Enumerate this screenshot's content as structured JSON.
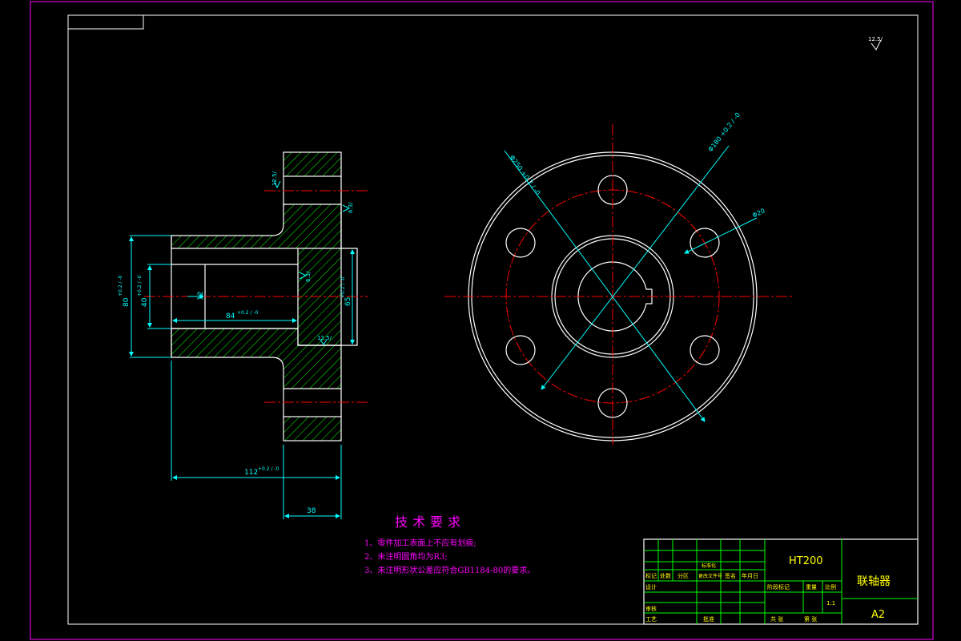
{
  "colors": {
    "background": "#000000",
    "frame": "#ff00ff",
    "outline": "#ffffff",
    "centerline": "#ff0000",
    "dimension": "#00ffff",
    "hatch": "#00ff00",
    "title_grid": "#00ff00",
    "title_text": "#ffff00"
  },
  "roughness": {
    "general": "12.5/",
    "bore_face": "6.3/",
    "bore_inner": "6.3/",
    "flange_hole": "12.5/",
    "flange_face": "12.5/"
  },
  "section_view": {
    "dim_overall_dia": "80",
    "dim_overall_dia_tol": "+0.2 / -0",
    "dim_shaft_dia": "40",
    "dim_shaft_dia_tol": "+0.2 / -0",
    "dim_keyway": "12",
    "dim_bore_depth": "84",
    "dim_bore_depth_tol": "+0.2 / -0",
    "dim_bore_dia": "65",
    "dim_bore_dia_tol": "+0.2 / -0",
    "dim_total_length": "112",
    "dim_total_length_tol": "+0.2 / -0",
    "dim_flange_thickness": "38"
  },
  "front_view": {
    "dim_outer": "Φ250 +0.2 / -0",
    "dim_pcd": "Φ180 +0.2 / -0",
    "dim_hole": "Φ20"
  },
  "tech_requirements": {
    "title": "技术要求",
    "items": [
      "1、零件加工表面上不应有划痕;",
      "2、未注明圆角均为R3;",
      "3、未注明形状公差应符合GB1184-80的要求。"
    ]
  },
  "title_block": {
    "material": "HT200",
    "part_name": "联轴器",
    "sheet_size": "A2",
    "scale": "1:1",
    "labels": {
      "mark": "标记",
      "count": "处数",
      "zone": "分区",
      "change_doc": "更改文件号",
      "sign": "签名",
      "date": "年月日",
      "design": "设计",
      "standardization": "标准化",
      "review": "审核",
      "process": "工艺",
      "approve": "批准",
      "stage_mark": "阶段标记",
      "weight": "重量",
      "scale": "比例",
      "sheets_total": "共 张",
      "sheet_no": "第 张"
    }
  }
}
